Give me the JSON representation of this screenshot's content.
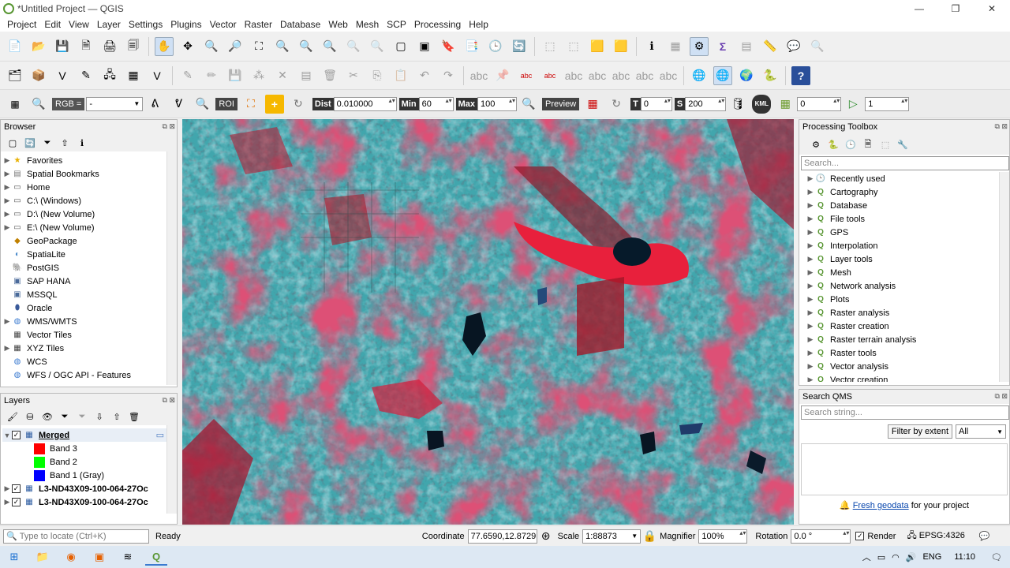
{
  "window": {
    "title": "*Untitled Project — QGIS",
    "min": "—",
    "max": "❐",
    "close": "✕"
  },
  "menu": [
    "Project",
    "Edit",
    "View",
    "Layer",
    "Settings",
    "Plugins",
    "Vector",
    "Raster",
    "Database",
    "Web",
    "Mesh",
    "SCP",
    "Processing",
    "Help"
  ],
  "scp_toolbar": {
    "rgb_label": "RGB =",
    "rgb_value": "-",
    "roi_label": "ROI",
    "dist_label": "Dist",
    "dist_value": "0.010000",
    "min_label": "Min",
    "min_value": "60",
    "max_label": "Max",
    "max_value": "100",
    "preview_label": "Preview",
    "t_label": "T",
    "t_value": "0",
    "s_label": "S",
    "s_value": "200",
    "kml_label": "KML",
    "band_value": "0",
    "step_value": "1"
  },
  "browser": {
    "title": "Browser",
    "items": [
      {
        "label": "Favorites",
        "icon": "star-icon",
        "expand": true
      },
      {
        "label": "Spatial Bookmarks",
        "icon": "bookmark-icon",
        "expand": true
      },
      {
        "label": "Home",
        "icon": "folder-icon",
        "expand": true
      },
      {
        "label": "C:\\ (Windows)",
        "icon": "folder-icon",
        "expand": true
      },
      {
        "label": "D:\\ (New Volume)",
        "icon": "folder-icon",
        "expand": true
      },
      {
        "label": "E:\\ (New Volume)",
        "icon": "folder-icon",
        "expand": true
      },
      {
        "label": "GeoPackage",
        "icon": "geopackage-icon",
        "expand": false
      },
      {
        "label": "SpatiaLite",
        "icon": "spatialite-icon",
        "expand": false
      },
      {
        "label": "PostGIS",
        "icon": "postgis-icon",
        "expand": false
      },
      {
        "label": "SAP HANA",
        "icon": "database-icon",
        "expand": false
      },
      {
        "label": "MSSQL",
        "icon": "database-icon",
        "expand": false
      },
      {
        "label": "Oracle",
        "icon": "oracle-icon",
        "expand": false
      },
      {
        "label": "WMS/WMTS",
        "icon": "globe-icon",
        "expand": true
      },
      {
        "label": "Vector Tiles",
        "icon": "grid-icon",
        "expand": false
      },
      {
        "label": "XYZ Tiles",
        "icon": "grid-icon",
        "expand": true
      },
      {
        "label": "WCS",
        "icon": "globe-icon",
        "expand": false
      },
      {
        "label": "WFS / OGC API - Features",
        "icon": "globe-icon",
        "expand": false
      }
    ]
  },
  "layers": {
    "title": "Layers",
    "items": [
      {
        "label": "Merged",
        "type": "group"
      },
      {
        "label": "Band 3",
        "type": "band",
        "color": "#ff0000"
      },
      {
        "label": "Band 2",
        "type": "band",
        "color": "#00ff00"
      },
      {
        "label": "Band 1 (Gray)",
        "type": "band",
        "color": "#0000ff"
      },
      {
        "label": "L3-ND43X09-100-064-27Oc",
        "type": "raster"
      },
      {
        "label": "L3-ND43X09-100-064-27Oc",
        "type": "raster"
      }
    ]
  },
  "processing": {
    "title": "Processing Toolbox",
    "search_placeholder": "Search...",
    "items": [
      "Recently used",
      "Cartography",
      "Database",
      "File tools",
      "GPS",
      "Interpolation",
      "Layer tools",
      "Mesh",
      "Network analysis",
      "Plots",
      "Raster analysis",
      "Raster creation",
      "Raster terrain analysis",
      "Raster tools",
      "Vector analysis",
      "Vector creation"
    ]
  },
  "qms": {
    "title": "Search QMS",
    "search_placeholder": "Search string...",
    "filter_button": "Filter by extent",
    "filter_value": "All",
    "fresh_link": "Fresh geodata",
    "fresh_text": "for your project"
  },
  "status": {
    "locate_placeholder": "Type to locate (Ctrl+K)",
    "ready": "Ready",
    "coordinate_label": "Coordinate",
    "coordinate_value": "77.6590,12.8729",
    "scale_label": "Scale",
    "scale_value": "1:88873",
    "magnifier_label": "Magnifier",
    "magnifier_value": "100%",
    "rotation_label": "Rotation",
    "rotation_value": "0.0 °",
    "render_label": "Render",
    "crs": "EPSG:4326"
  },
  "taskbar": {
    "lang": "ENG",
    "time": "11:10"
  }
}
